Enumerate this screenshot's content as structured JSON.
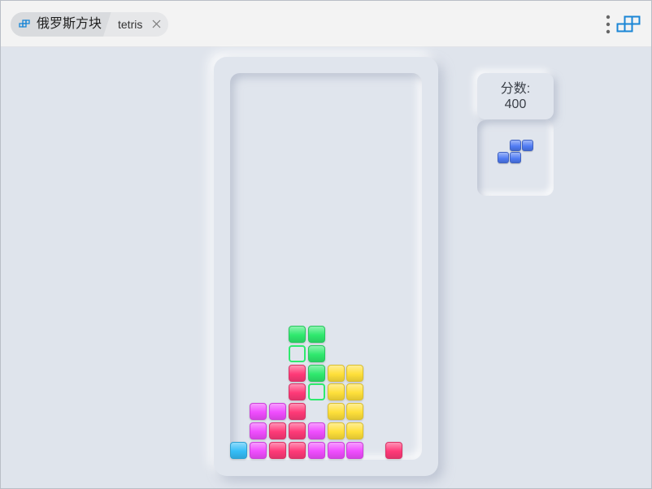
{
  "window": {
    "tabs": [
      {
        "label": "俄罗斯方块"
      },
      {
        "label": "tetris"
      }
    ]
  },
  "score": {
    "label": "分数:",
    "value": "400"
  },
  "colors": {
    "red": "#ff3a78",
    "magenta": "#f04dff",
    "yellow": "#ffe03a",
    "green": "#2fe96e",
    "cyan": "#35bdf7",
    "blue": "#4f7bf3",
    "accent": "#1a86d6"
  },
  "board": {
    "columns": 9,
    "rows": 20,
    "cells": [
      {
        "row": 13,
        "col": 3,
        "color": "green"
      },
      {
        "row": 13,
        "col": 4,
        "color": "green"
      },
      {
        "row": 14,
        "col": 3,
        "color": "green",
        "style": "outline"
      },
      {
        "row": 14,
        "col": 4,
        "color": "green"
      },
      {
        "row": 15,
        "col": 3,
        "color": "red"
      },
      {
        "row": 15,
        "col": 4,
        "color": "green"
      },
      {
        "row": 15,
        "col": 5,
        "color": "yellow"
      },
      {
        "row": 15,
        "col": 6,
        "color": "yellow"
      },
      {
        "row": 16,
        "col": 3,
        "color": "red"
      },
      {
        "row": 16,
        "col": 4,
        "color": "green",
        "style": "outline"
      },
      {
        "row": 16,
        "col": 5,
        "color": "yellow"
      },
      {
        "row": 16,
        "col": 6,
        "color": "yellow"
      },
      {
        "row": 17,
        "col": 1,
        "color": "magenta"
      },
      {
        "row": 17,
        "col": 2,
        "color": "magenta"
      },
      {
        "row": 17,
        "col": 3,
        "color": "red"
      },
      {
        "row": 17,
        "col": 5,
        "color": "yellow"
      },
      {
        "row": 17,
        "col": 6,
        "color": "yellow"
      },
      {
        "row": 18,
        "col": 1,
        "color": "magenta"
      },
      {
        "row": 18,
        "col": 2,
        "color": "red"
      },
      {
        "row": 18,
        "col": 3,
        "color": "red"
      },
      {
        "row": 18,
        "col": 4,
        "color": "magenta"
      },
      {
        "row": 18,
        "col": 5,
        "color": "yellow"
      },
      {
        "row": 18,
        "col": 6,
        "color": "yellow"
      },
      {
        "row": 19,
        "col": 0,
        "color": "cyan"
      },
      {
        "row": 19,
        "col": 1,
        "color": "magenta"
      },
      {
        "row": 19,
        "col": 2,
        "color": "red"
      },
      {
        "row": 19,
        "col": 3,
        "color": "red"
      },
      {
        "row": 19,
        "col": 4,
        "color": "magenta"
      },
      {
        "row": 19,
        "col": 5,
        "color": "magenta"
      },
      {
        "row": 19,
        "col": 6,
        "color": "magenta"
      },
      {
        "row": 19,
        "col": 8,
        "color": "red"
      }
    ]
  },
  "next_piece": {
    "shape": "S",
    "color": "blue",
    "cells": [
      {
        "row": 0,
        "col": 1
      },
      {
        "row": 0,
        "col": 2
      },
      {
        "row": 1,
        "col": 0
      },
      {
        "row": 1,
        "col": 1
      }
    ]
  }
}
